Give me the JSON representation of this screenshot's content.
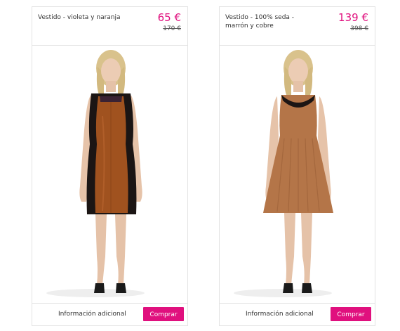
{
  "products": [
    {
      "name": "Vestido - violeta y naranja",
      "price": "65 €",
      "old_price": "170 €",
      "info_label": "Información adicional",
      "buy_label": "Comprar"
    },
    {
      "name": "Vestido - 100% seda - marrón y cobre",
      "price": "139 €",
      "old_price": "398 €",
      "info_label": "Información adicional",
      "buy_label": "Comprar"
    }
  ],
  "colors": {
    "accent": "#e0107e",
    "border": "#e3e3e3",
    "dress1_main": "#a0521f",
    "dress1_side": "#1b1514",
    "dress2_main": "#b47548",
    "skin": "#e8c6ad",
    "hair": "#d9c28c"
  }
}
